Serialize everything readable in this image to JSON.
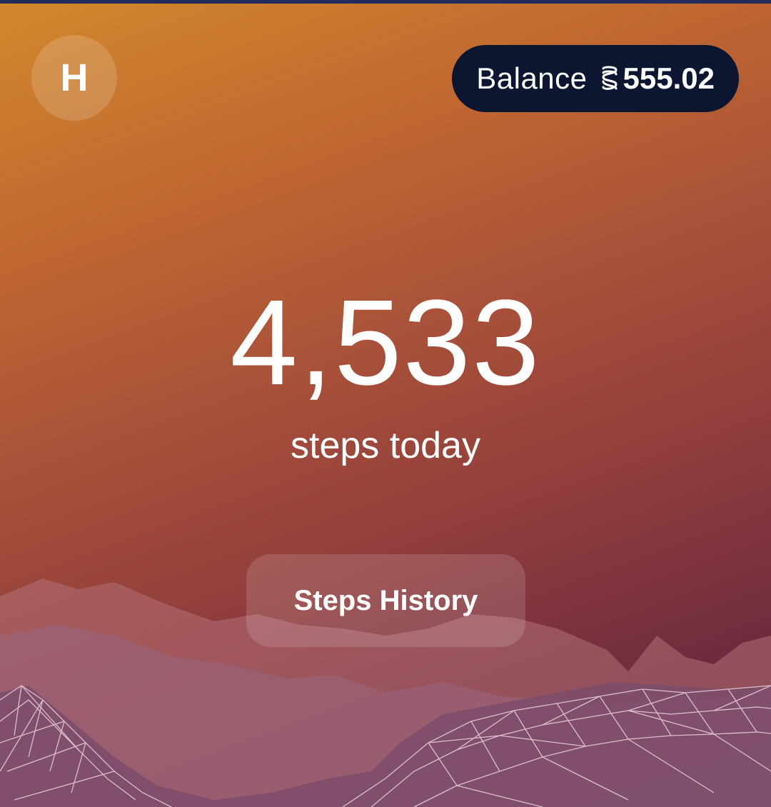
{
  "header": {
    "avatar_initial": "H",
    "balance": {
      "label": "Balance",
      "currency_icon": "coin-icon",
      "amount": "555.02"
    }
  },
  "main": {
    "steps_count": "4,533",
    "steps_label": "steps today",
    "history_button_label": "Steps History"
  },
  "colors": {
    "gradient_top": "#d3882c",
    "gradient_bottom": "#5c2545",
    "balance_pill": "#0c1631",
    "text": "#ffffff"
  }
}
